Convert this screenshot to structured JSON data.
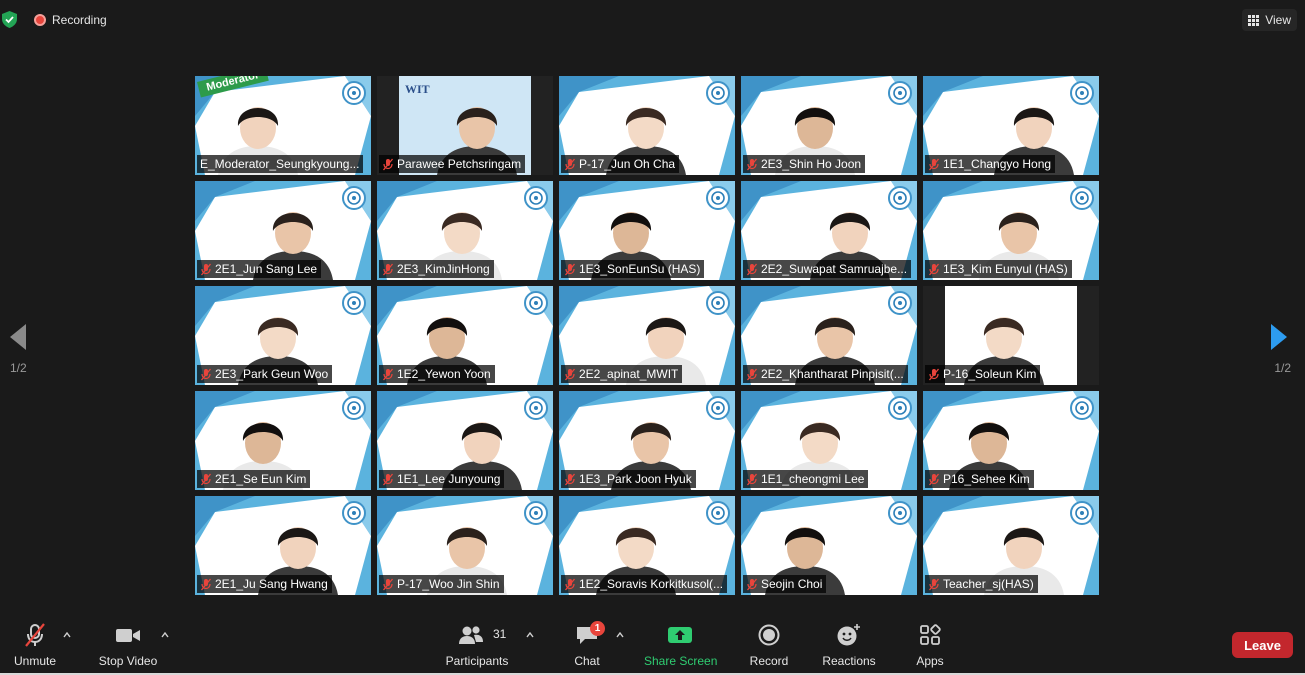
{
  "topbar": {
    "recording_label": "Recording",
    "view_label": "View"
  },
  "pagination": {
    "left": "1/2",
    "right": "1/2"
  },
  "moderator_badge": "Moderator",
  "participants": [
    "E_Moderator_Seungkyoung...",
    "Parawee Petchsringam",
    "P-17_Jun Oh Cha",
    "2E3_Shin Ho Joon",
    "1E1_Changyo Hong",
    "2E1_Jun Sang Lee",
    "2E3_KimJinHong",
    "1E3_SonEunSu (HAS)",
    "2E2_Suwapat Samruajbe...",
    "1E3_Kim Eunyul (HAS)",
    "2E3_Park Geun Woo",
    "1E2_Yewon Yoon",
    "2E2_apinat_MWIT",
    "2E2_Khantharat Pinpisit(...",
    "P-16_Soleun Kim",
    "2E1_Se Eun Kim",
    "1E1_Lee Junyoung",
    "1E3_Park Joon Hyuk",
    "1E1_cheongmi Lee",
    "P16_Sehee Kim",
    "2E1_Ju Sang Hwang",
    "P-17_Woo Jin Shin",
    "1E2_Soravis Korkitkusol(...",
    "Seojin Choi",
    "Teacher_sj(HAS)"
  ],
  "toolbar": {
    "unmute": "Unmute",
    "stop_video": "Stop Video",
    "participants": "Participants",
    "participants_count": "31",
    "chat": "Chat",
    "chat_badge": "1",
    "share_screen": "Share Screen",
    "record": "Record",
    "reactions": "Reactions",
    "apps": "Apps",
    "leave": "Leave"
  },
  "colors": {
    "share_green": "#2fcc71",
    "leave_red": "#c3272d",
    "active_speaker": "#d9e86a",
    "tile_blue": "#58b0dc"
  }
}
